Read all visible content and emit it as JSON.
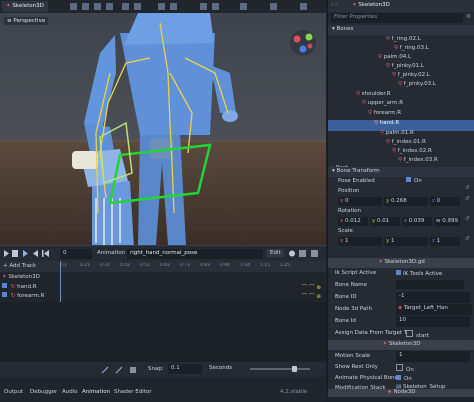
{
  "viewport": {
    "tab_title": "Skeleton3D",
    "perspective_label": "Perspective"
  },
  "animation_panel": {
    "frame_value": "0",
    "animation_label": "Animation",
    "animation_name": "right_hand_normal_pose",
    "edit_label": "Edit",
    "add_track_label": "+ Add Track",
    "time_ticks": [
      "0.1",
      "0.21",
      "0.31",
      "0.42",
      "0.52",
      "0.62",
      "0.73",
      "0.83",
      "0.94",
      "1.04",
      "1.15",
      "1.25"
    ],
    "tracks_group": "Skeleton3D",
    "tracks": [
      {
        "name": "hand.R"
      },
      {
        "name": "forearm.R"
      }
    ],
    "snap_label": "Snap:",
    "snap_value": "0.1",
    "snap_unit": "Seconds"
  },
  "bottom_tabs": [
    "Output",
    "Debugger",
    "Audio",
    "Animation",
    "Shader Editor"
  ],
  "bottom_version": "4.2.stable",
  "inspector": {
    "header_title": "Skeleton3D",
    "filter_placeholder": "Filter Properties",
    "bones_section": "Bones",
    "bone_tree": [
      {
        "label": "f_ring.02.L"
      },
      {
        "label": "f_ring.03.L"
      },
      {
        "label": "palm.04.L"
      },
      {
        "label": "f_pinky.01.L"
      },
      {
        "label": "f_pinky.02.L"
      },
      {
        "label": "f_pinky.03.L"
      },
      {
        "label": "shoulder.R"
      },
      {
        "label": "upper_arm.R"
      },
      {
        "label": "forearm.R"
      },
      {
        "label": "hand.R"
      },
      {
        "label": "palm.01.R"
      },
      {
        "label": "f_index.01.R"
      },
      {
        "label": "f_index.02.R"
      },
      {
        "label": "f_index.03.R"
      }
    ],
    "rest_label": "Rest",
    "bone_transform_section": "Bone Transform",
    "pose_enabled_label": "Pose Enabled",
    "pose_enabled_value": "On",
    "position_label": "Position",
    "position": {
      "x": "0",
      "y": "0.268",
      "z": "0"
    },
    "rotation_label": "Rotation",
    "rotation": {
      "x": "0.012",
      "y": "0.01",
      "z": "0.039",
      "w": "0.999"
    },
    "scale_label": "Scale",
    "scale": {
      "x": "1",
      "y": "1",
      "z": "1"
    },
    "ik_script_title": "Skeleton3D.gd",
    "ik_fields": [
      {
        "label": "Ik Script Active",
        "value": "IK Tools Active"
      },
      {
        "label": "Bone Name",
        "value": ""
      },
      {
        "label": "Bone ID",
        "value": "-1"
      },
      {
        "label": "Node 3d Path",
        "value": "Target_Left_Han"
      },
      {
        "label": "Bone Id",
        "value": "10"
      },
      {
        "label": "Assign Data From Target T",
        "value": "start"
      }
    ],
    "skeleton_section_title": "Skeleton3D",
    "skeleton_fields": [
      {
        "label": "Motion Scale",
        "value": "1"
      },
      {
        "label": "Show Rest Only",
        "value": "On"
      },
      {
        "label": "Animate Physical Bones",
        "value": "On"
      },
      {
        "label": "Modification Stack",
        "value": "Skeleton_Setup"
      }
    ],
    "node3d_label": "Node3D"
  },
  "colors": {
    "accent": "#3b5f99",
    "panel_bg": "#262b33",
    "viewport_sky": "#3a3e46",
    "viewport_ground": "#514035",
    "character_blue": "#5f90d8",
    "gizmo_green": "#22d43a"
  }
}
